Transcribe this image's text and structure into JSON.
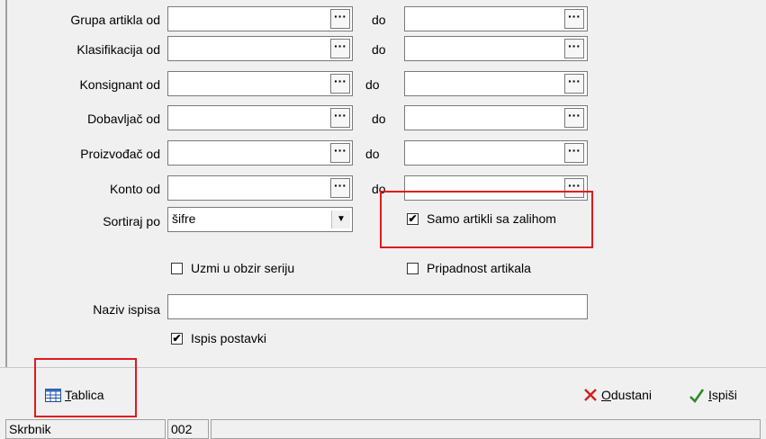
{
  "rows": [
    {
      "label": "Grupa artikla od",
      "to_label": "do",
      "from_value": "",
      "to_value": ""
    },
    {
      "label": "Klasifikacija od",
      "to_label": "do",
      "from_value": "",
      "to_value": ""
    },
    {
      "label": "Konsignant od",
      "to_label": "do",
      "from_value": "",
      "to_value": ""
    },
    {
      "label": "Dobavljač od",
      "to_label": "do",
      "from_value": "",
      "to_value": ""
    },
    {
      "label": "Proizvođač od",
      "to_label": "do",
      "from_value": "",
      "to_value": ""
    },
    {
      "label": "Konto od",
      "to_label": "do",
      "from_value": "",
      "to_value": ""
    }
  ],
  "browse_button_label": "···",
  "sort": {
    "label": "Sortiraj po",
    "value": "šifre"
  },
  "checkboxes": {
    "samo_artikli": {
      "label": "Samo artikli sa zalihom",
      "checked": true
    },
    "uzmi_seriju": {
      "label": "Uzmi u obzir seriju",
      "checked": false
    },
    "pripadnost": {
      "label": "Pripadnost artikala",
      "checked": false
    },
    "ispis_postavki": {
      "label": "Ispis postavki",
      "checked": true
    }
  },
  "naziv": {
    "label": "Naziv ispisa",
    "value": ""
  },
  "footer": {
    "tablica": "Tablica",
    "odustani": "Odustani",
    "ispisi": "Ispiši"
  },
  "status": {
    "user": "Skrbnik",
    "code": "002",
    "extra": ""
  },
  "colors": {
    "highlight": "#e0191e",
    "check_green": "#2e8b22",
    "cancel_red": "#d42020"
  }
}
